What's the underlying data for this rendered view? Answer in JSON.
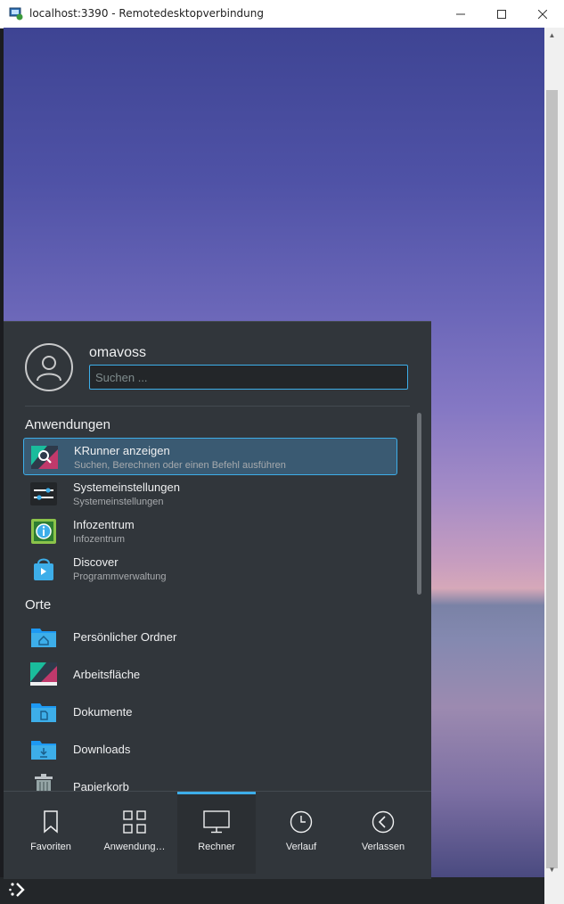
{
  "window": {
    "title": "localhost:3390 - Remotedesktopverbindung",
    "minimize": "minimize-icon",
    "maximize": "maximize-icon",
    "close": "close-icon"
  },
  "menu": {
    "username": "omavoss",
    "search": {
      "placeholder": "Suchen ...",
      "value": ""
    },
    "sections": {
      "applications": "Anwendungen",
      "places": "Orte"
    },
    "applications": [
      {
        "name": "KRunner anzeigen",
        "desc": "Suchen, Berechnen oder einen Befehl ausführen",
        "icon": "krunner-icon"
      },
      {
        "name": "Systemeinstellungen",
        "desc": "Systemeinstellungen",
        "icon": "settings-icon"
      },
      {
        "name": "Infozentrum",
        "desc": "Infozentrum",
        "icon": "info-icon"
      },
      {
        "name": "Discover",
        "desc": "Programmverwaltung",
        "icon": "discover-icon"
      }
    ],
    "places": [
      {
        "name": "Persönlicher Ordner",
        "icon": "home-folder-icon"
      },
      {
        "name": "Arbeitsfläche",
        "icon": "desktop-icon"
      },
      {
        "name": "Dokumente",
        "icon": "documents-folder-icon"
      },
      {
        "name": "Downloads",
        "icon": "downloads-folder-icon"
      },
      {
        "name": "Papierkorb",
        "icon": "trash-icon"
      }
    ],
    "tabs": [
      {
        "label": "Favoriten",
        "icon": "bookmark-icon"
      },
      {
        "label": "Anwendung…",
        "icon": "grid-icon"
      },
      {
        "label": "Rechner",
        "icon": "computer-icon"
      },
      {
        "label": "Verlauf",
        "icon": "clock-icon"
      },
      {
        "label": "Verlassen",
        "icon": "back-icon"
      }
    ],
    "active_tab": "Rechner"
  },
  "colors": {
    "accent": "#3daee9",
    "panel": "#31363b",
    "text": "#eff0f1"
  }
}
